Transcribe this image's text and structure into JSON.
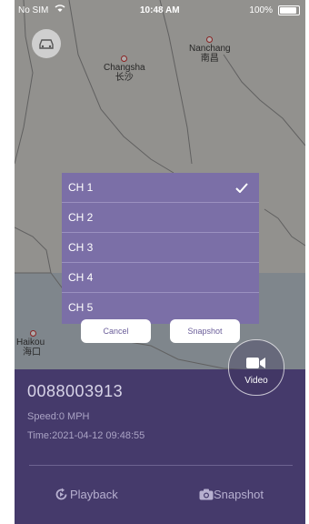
{
  "status_bar": {
    "carrier": "No SIM",
    "time": "10:48 AM",
    "battery": "100%"
  },
  "map": {
    "cities": [
      {
        "name": "Nanchang",
        "name_cn": "南昌"
      },
      {
        "name": "Changsha",
        "name_cn": "长沙"
      },
      {
        "name": "Haikou",
        "name_cn": "海口"
      }
    ]
  },
  "channel_menu": {
    "items": [
      "CH 1",
      "CH 2",
      "CH 3",
      "CH 4",
      "CH 5"
    ],
    "selected": "CH 1",
    "cancel_label": "Cancel",
    "snapshot_label": "Snapshot"
  },
  "info_panel": {
    "device_id": "0088003913",
    "speed": "Speed:0 MPH",
    "time": "Time:2021-04-12 09:48:55",
    "video_label": "Video",
    "playback_label": "Playback",
    "snapshot_label": "Snapshot"
  },
  "colors": {
    "panel": "#453a6b",
    "menu": "#7b6fa7",
    "accent_text": "#6a5d99"
  },
  "icons": [
    "wifi-icon",
    "battery-icon",
    "car-icon",
    "checkmark-icon",
    "video-camera-icon",
    "playback-icon",
    "camera-icon"
  ]
}
